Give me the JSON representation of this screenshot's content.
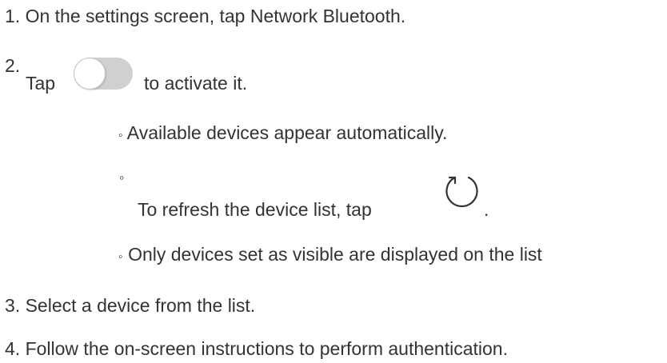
{
  "steps": {
    "s1": {
      "number": "1.",
      "text": "On the settings screen, tap Network Bluetooth."
    },
    "s2": {
      "number": "2.",
      "before": "Tap",
      "after": "to activate it.",
      "bullets": {
        "b1": {
          "marker": "◦",
          "text": "Available devices appear automatically."
        },
        "b2": {
          "marker": "◦",
          "text": "To refresh the device list, tap",
          "suffix": "."
        },
        "b3": {
          "marker": "◦",
          "text": "Only devices set as visible are displayed on the list"
        }
      }
    },
    "s3": {
      "number": "3.",
      "text": "Select a device from the list."
    },
    "s4": {
      "number": "4.",
      "text": "Follow the on-screen instructions to perform authentication."
    }
  },
  "icons": {
    "toggle": "toggle-switch-off-icon",
    "refresh": "refresh-icon"
  },
  "colors": {
    "text": "#333333",
    "toggle_track": "#d0d0d0",
    "toggle_knob": "#ffffff"
  }
}
